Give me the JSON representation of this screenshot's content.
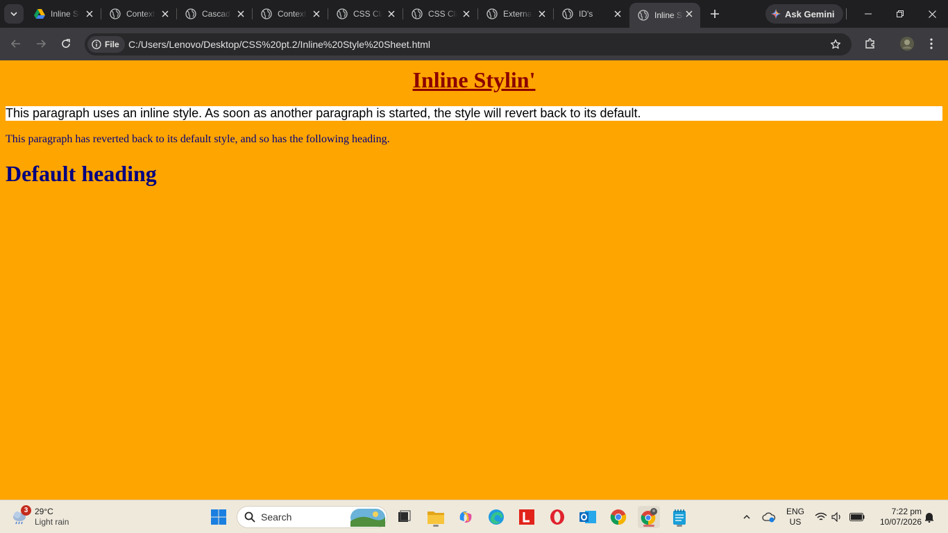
{
  "browser": {
    "tabs": [
      {
        "title": "Inline Style Sheet",
        "favicon": "google-drive-icon",
        "active": false
      },
      {
        "title": "Contextual Selectors",
        "favicon": "globe-icon",
        "active": false
      },
      {
        "title": "Cascading Style Sheets",
        "favicon": "globe-icon",
        "active": false
      },
      {
        "title": "Contextual Selectors",
        "favicon": "globe-icon",
        "active": false
      },
      {
        "title": "CSS Classes",
        "favicon": "globe-icon",
        "active": false
      },
      {
        "title": "CSS Classes",
        "favicon": "globe-icon",
        "active": false
      },
      {
        "title": "External Style Sheet",
        "favicon": "globe-icon",
        "active": false
      },
      {
        "title": "ID's",
        "favicon": "globe-icon",
        "active": false
      },
      {
        "title": "Inline Style Sheet",
        "favicon": "globe-icon",
        "active": true
      }
    ],
    "gemini_label": "Ask Gemini",
    "site_chip": "File",
    "url": "C:/Users/Lenovo/Desktop/CSS%20pt.2/Inline%20Style%20Sheet.html"
  },
  "page": {
    "heading": "Inline Stylin'",
    "inline_paragraph": "This paragraph uses an inline style. As soon as another paragraph is started, the style will revert back to its default.",
    "default_paragraph": "This paragraph has reverted back to its default style, and so has the following heading.",
    "default_heading": "Default heading",
    "colors": {
      "background": "#ffa500",
      "heading": "#8b0000",
      "default_text": "#000080",
      "inline_bg": "#ffffff"
    }
  },
  "taskbar": {
    "weather": {
      "badge": "3",
      "temperature": "29°C",
      "condition": "Light rain"
    },
    "search_placeholder": "Search",
    "language": {
      "line1": "ENG",
      "line2": "US"
    },
    "clock": {
      "time": "7:22 pm",
      "date": "10/07/2026"
    }
  }
}
